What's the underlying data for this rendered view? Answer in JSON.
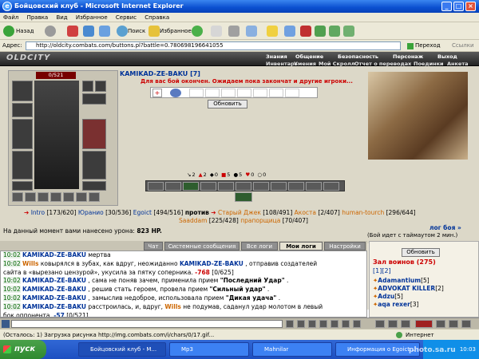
{
  "window": {
    "title": "Бойцовский клуб - Microsoft Internet Explorer"
  },
  "menu": [
    "Файл",
    "Правка",
    "Вид",
    "Избранное",
    "Сервис",
    "Справка"
  ],
  "toolbar": {
    "back": "Назад",
    "search": "Поиск",
    "favorites": "Избранное"
  },
  "address": {
    "label": "Адрес:",
    "url": "http://oldcity.combats.com/buttons.pl?battle=0.780698196641055",
    "go": "Переход",
    "links": "Ссылки"
  },
  "site": {
    "logo": "OLDCITY",
    "nav_top": [
      "Знания",
      "Общение",
      "Безопасность",
      "Персонаж",
      "Выход"
    ],
    "nav_bottom": [
      "Инвентарь",
      "Умения",
      "Мой Скролл",
      "Отчет о переводах",
      "Поединки",
      "Анкета"
    ]
  },
  "character": {
    "hp": "0/521",
    "name": "KAMIKAD-ZE-BAKU",
    "level": "[7]"
  },
  "battle": {
    "message": "Для вас бой окончен. Ожидаем пока закончат и другие игроки...",
    "refresh": "Обновить",
    "stats": [
      "2",
      "2",
      "0",
      "5",
      "5",
      "0",
      "0"
    ],
    "team1": [
      {
        "name": "Intro",
        "hp": "[173/620]"
      },
      {
        "name": "Юранио",
        "hp": "[30/536]"
      },
      {
        "name": "Egoict",
        "hp": "[494/516]"
      }
    ],
    "vs": "против",
    "team2": [
      {
        "name": "Старый Джек",
        "hp": "[108/491]"
      },
      {
        "name": "Акоста",
        "hp": "[2/407]"
      },
      {
        "name": "human-tourch",
        "hp": "[296/644]"
      },
      {
        "name": "Saaddam",
        "hp": "[225/428]"
      },
      {
        "name": "прапорщица",
        "hp": "[70/407]"
      }
    ],
    "damage_label": "На данный момент вами нанесено урона:",
    "damage_value": "823 HP.",
    "log_link": "лог боя »",
    "timeout": "(Бой идет с таймаутом 2 мин.)"
  },
  "tabs": [
    "Чат",
    "Системные сообщения",
    "Все логи",
    "Мои логи",
    "Настройки"
  ],
  "chat": [
    {
      "time": "10:02",
      "parts": [
        [
          "nk",
          "KAMIKAD-ZE-BAKU"
        ],
        [
          "",
          "мертва"
        ]
      ]
    },
    {
      "time": "10:02",
      "parts": [
        [
          "or",
          "Wills"
        ],
        [
          "",
          "ковырялся в зубах, как вдруг, неожиданно"
        ],
        [
          "nk",
          "KAMIKAD-ZE-BAKU"
        ],
        [
          "",
          ", отправив создателей"
        ]
      ]
    },
    {
      "time": "",
      "parts": [
        [
          "",
          "сайта в «вырезано цензурой», укусила за пятку соперника."
        ],
        [
          "rd",
          "-768"
        ],
        [
          "",
          "[0/625]"
        ]
      ]
    },
    {
      "time": "10:02",
      "parts": [
        [
          "nk",
          "KAMIKAD-ZE-BAKU"
        ],
        [
          "",
          ", сама не поняв зачем, применила прием"
        ],
        [
          "b",
          "\"Последний Удар\""
        ],
        [
          "",
          "."
        ]
      ]
    },
    {
      "time": "10:02",
      "parts": [
        [
          "nk",
          "KAMIKAD-ZE-BAKU"
        ],
        [
          "",
          ", решив стать героем, провела прием"
        ],
        [
          "b",
          "\"Сильный удар\""
        ],
        [
          "",
          "."
        ]
      ]
    },
    {
      "time": "10:02",
      "parts": [
        [
          "nk",
          "KAMIKAD-ZE-BAKU"
        ],
        [
          "",
          ", замыслив недоброе, использовала прием"
        ],
        [
          "b",
          "\"Дикая удача\""
        ],
        [
          "",
          "."
        ]
      ]
    },
    {
      "time": "10:02",
      "parts": [
        [
          "nk",
          "KAMIKAD-ZE-BAKU"
        ],
        [
          "",
          "расстроилась, и, вдруг,"
        ],
        [
          "or",
          "Wills"
        ],
        [
          "",
          "не подумав, саданул удар молотом в левый"
        ]
      ]
    },
    {
      "time": "",
      "parts": [
        [
          "",
          "бок оппонента."
        ],
        [
          "bl",
          "-57"
        ],
        [
          "",
          "[0/521]"
        ]
      ]
    },
    {
      "time": "10:02",
      "parts": [
        [
          "nk",
          "KAMIKAD-ZE-BAKU"
        ],
        [
          "",
          ", выкрикнув: «А ещё я вот так могу!», показала прием"
        ],
        [
          "b",
          "\"Рывок\""
        ],
        [
          "",
          ". (Защита от"
        ]
      ]
    }
  ],
  "side": {
    "refresh": "Обновить",
    "hall": "Зал воинов (275)",
    "pages": "[1][2]",
    "players": [
      {
        "name": "Adamantium",
        "lvl": "[5]"
      },
      {
        "name": "ADVOKAT KILLER",
        "lvl": "[2]"
      },
      {
        "name": "Adzu",
        "lvl": "[5]"
      },
      {
        "name": "aqa rexer",
        "lvl": "[3]"
      }
    ]
  },
  "status": {
    "text": "(Осталось: 1) Загрузка рисунка http://img.combats.com/i/chars/0/17.gif...",
    "zone": "Интернет"
  },
  "taskbar": {
    "start": "пуск",
    "tasks": [
      "Бойцовский клуб - M...",
      "Mp3",
      "Mahnilar",
      "Информация о Egoict..."
    ],
    "clock": "10:03"
  },
  "colors": {
    "accent": "#cc0000",
    "xp_blue": "#0a4fd0"
  },
  "watermark": "photo.sa.ru"
}
